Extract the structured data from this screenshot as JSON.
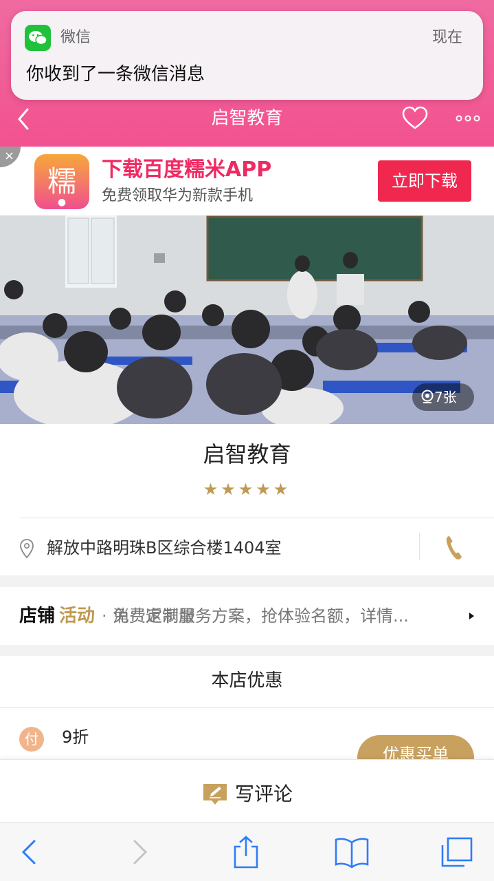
{
  "notification": {
    "app": "微信",
    "time": "现在",
    "message": "你收到了一条微信消息"
  },
  "nav": {
    "title": "启智教育",
    "back_icon": "chevron-left-icon",
    "favorite_icon": "heart-icon",
    "more_icon": "more-dots-icon"
  },
  "ad": {
    "logo_char": "糯",
    "title": "下载百度糯米APP",
    "subtitle": "免费领取华为新款手机",
    "button": "立即下载",
    "close": "×"
  },
  "photo": {
    "count": "7张"
  },
  "shop": {
    "name": "启智教育",
    "rating": 5,
    "stars": "★★★★★",
    "address": "解放中路明珠B区综合楼1404室"
  },
  "activity": {
    "label_1": "店铺",
    "label_2": "活动",
    "separator": "·",
    "text": "免费定制服务方案，抢体验名额，详情...",
    "overlap_text": "消费返满量"
  },
  "coupon": {
    "section_title": "本店优惠",
    "badge": "付",
    "discount": "9折",
    "button": "优惠买单"
  },
  "review": {
    "label": "写评论"
  },
  "colors": {
    "header_pink": "#f25290",
    "ad_red": "#f0274e",
    "gold": "#bf9a52",
    "wechat_green": "#1fc23a",
    "safari_blue": "#2f7cf6"
  }
}
